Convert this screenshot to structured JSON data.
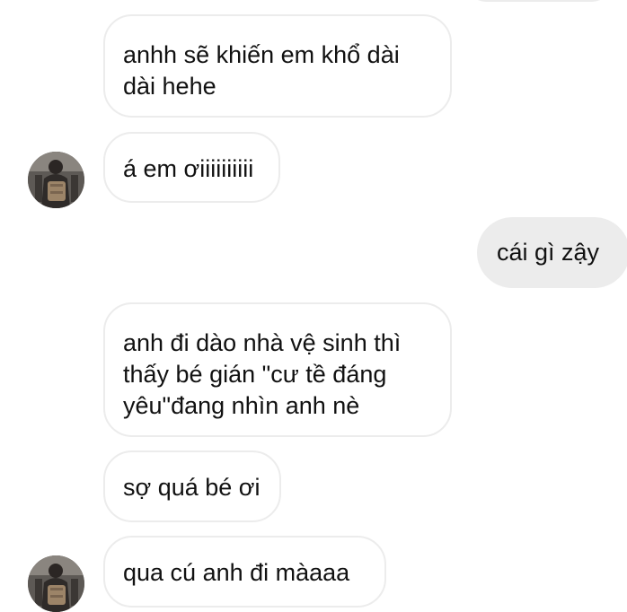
{
  "conversation": {
    "messages": [
      {
        "direction": "in",
        "text": "anhh sẽ khiến em khổ dài dài hehe"
      },
      {
        "direction": "in",
        "text": "á em ơiiiiiiiiii",
        "avatar": "contact-avatar-photo"
      },
      {
        "direction": "out",
        "text": "cái gì zậy"
      },
      {
        "direction": "in",
        "text": "anh đi dào nhà vệ sinh thì thấy bé gián \"cư tề đáng yêu\"đang nhìn anh nè"
      },
      {
        "direction": "in",
        "text": "sợ quá bé ơi"
      },
      {
        "direction": "in",
        "text": "qua cú anh đi màaaa",
        "avatar": "contact-avatar-photo"
      }
    ]
  },
  "colors": {
    "incoming_bubble_border": "#ececec",
    "outgoing_bubble_bg": "#ececec",
    "text": "#111111"
  }
}
